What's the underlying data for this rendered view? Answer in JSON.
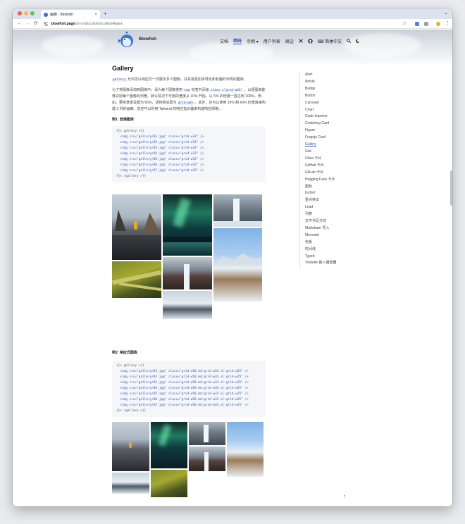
{
  "browser": {
    "tab_title": "画廊 · Blowfish",
    "url_host": "blowfish.page",
    "url_path": "/zh-cn/docs/shortcodes/#katex",
    "new_tab": "+",
    "tab_close": "×",
    "tab_menu": "⌄",
    "back": "←",
    "forward": "→",
    "reload": "⟳",
    "star": "☆",
    "more": "⋮"
  },
  "header": {
    "brand": "Blowfish",
    "nav": [
      {
        "label": "文档"
      },
      {
        "label": "简码"
      },
      {
        "label": "示例 ▾"
      },
      {
        "label": "用户列表"
      },
      {
        "label": "周边"
      }
    ],
    "lang": "简体中文"
  },
  "content": {
    "title": "Gallery",
    "intro_code": "gallery",
    "intro_text": " 允许您以响应式一次展示多个图像，并具有更加多样化和有趣的布局的图库。",
    "para2_a": "为了将图像添加到图库中，请为每个图像使用 ",
    "para2_code1": "img",
    "para2_b": " 标签并添加 ",
    "para2_code2": "class =\"grid-wXX\"",
    "para2_c": " ，以便图库能够识别每个图像的列宽。默认情况下可用的宽度从 10% 开始，以 5% 的增量一直达到 100%。例如，要将宽度设置为 65%，请将类设置为 ",
    "para2_code3": "grid-w65",
    "para2_d": " 。此外，还可以使用 33% 和 66% 的宽度来构建 3 列的画廊。您还可以利用 Tailwind 的响应指示器来构建响应网格。",
    "example1_title": "例1: 普通图库",
    "example1_code": [
      "{{< gallery >}}",
      "  <img src=\"gallery/01.jpg\" class=\"grid-w33\" />",
      "  <img src=\"gallery/02.jpg\" class=\"grid-w33\" />",
      "  <img src=\"gallery/03.jpg\" class=\"grid-w33\" />",
      "  <img src=\"gallery/04.jpg\" class=\"grid-w33\" />",
      "  <img src=\"gallery/05.jpg\" class=\"grid-w33\" />",
      "  <img src=\"gallery/06.jpg\" class=\"grid-w33\" />",
      "  <img src=\"gallery/07.jpg\" class=\"grid-w33\" />",
      "{{< /gallery >}}"
    ],
    "example2_title": "例2: 响应式图库",
    "example2_code": [
      "{{< gallery >}}",
      "  <img src=\"gallery/01.jpg\" class=\"grid-w50 md:grid-w33 xl:grid-w25\" />",
      "  <img src=\"gallery/02.jpg\" class=\"grid-w50 md:grid-w33 xl:grid-w25\" />",
      "  <img src=\"gallery/03.jpg\" class=\"grid-w50 md:grid-w33 xl:grid-w25\" />",
      "  <img src=\"gallery/04.jpg\" class=\"grid-w50 md:grid-w33 xl:grid-w25\" />",
      "  <img src=\"gallery/05.jpg\" class=\"grid-w50 md:grid-w33 xl:grid-w25\" />",
      "  <img src=\"gallery/06.jpg\" class=\"grid-w50 md:grid-w33 xl:grid-w25\" />",
      "  <img src=\"gallery/07.jpg\" class=\"grid-w50 md:grid-w33 xl:grid-w25\" />",
      "{{< /gallery >}}"
    ]
  },
  "toc": [
    "Alert",
    "Article",
    "Badge",
    "Button",
    "Carousel",
    "Chart",
    "Code Importer",
    "Codeberg Card",
    "Figure",
    "Forgejo Card",
    "Gallery",
    "Gist",
    "Gitea 卡片",
    "GitHub 卡片",
    "GitLab 卡片",
    "Hugging Face 卡片",
    "图标",
    "KaTeX",
    "重点突出",
    "Lead",
    "列表",
    "文字书写方向",
    "Markdown 导入",
    "Mermaid",
    "色板",
    "时间线",
    "TypeIt",
    "Youtube 嵌入播放器"
  ],
  "toc_active": "Gallery",
  "back_to_top": "↑"
}
